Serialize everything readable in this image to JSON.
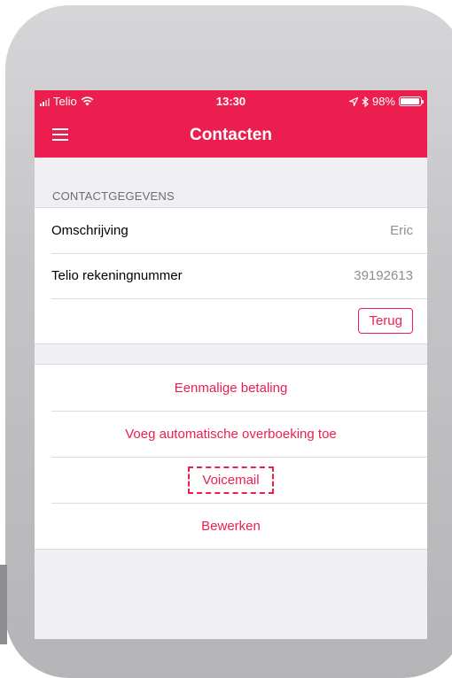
{
  "status_bar": {
    "carrier": "Telio",
    "time": "13:30",
    "battery": "98%",
    "battery_level": 0.98
  },
  "header": {
    "title": "Contacten"
  },
  "contact_section": {
    "heading": "CONTACTGEGEVENS",
    "rows": [
      {
        "label": "Omschrijving",
        "value": "Eric"
      },
      {
        "label": "Telio rekeningnummer",
        "value": "39192613"
      }
    ],
    "back_button": "Terug"
  },
  "actions": [
    "Eenmalige betaling",
    "Voeg automatische overboeking toe",
    "Voicemail",
    "Bewerken"
  ],
  "colors": {
    "accent": "#ec1e4f",
    "background": "#efeff4",
    "secondary_text": "#8e8e93"
  },
  "icons": {
    "menu": "hamburger-menu-icon",
    "wifi": "wifi-icon",
    "signal": "cell-signal-icon",
    "location": "location-arrow-icon",
    "bluetooth": "bluetooth-icon",
    "battery": "battery-icon"
  }
}
